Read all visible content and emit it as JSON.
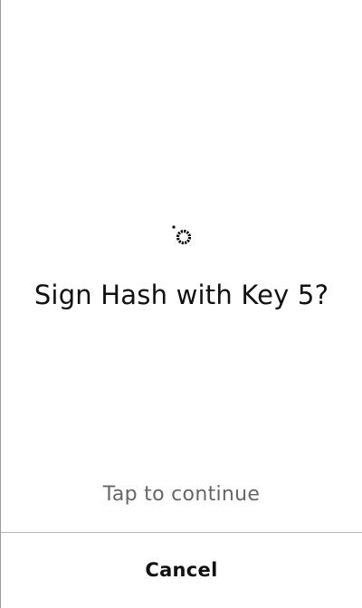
{
  "prompt": {
    "icon": "signature-pen-icon",
    "title": "Sign Hash with Key 5?",
    "hint": "Tap to continue"
  },
  "footer": {
    "cancel_label": "Cancel"
  },
  "colors": {
    "background": "#ffffff",
    "text": "#111111",
    "hint_text": "#666666",
    "divider": "#b5b5b5"
  }
}
